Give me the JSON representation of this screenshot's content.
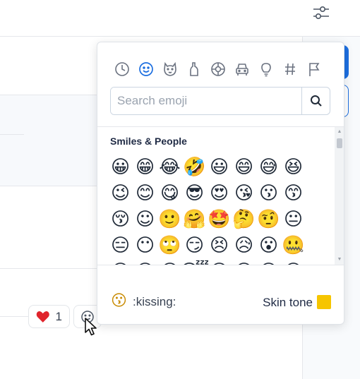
{
  "picker": {
    "categories": [
      {
        "name": "recent",
        "icon": "clock-icon"
      },
      {
        "name": "smileys",
        "icon": "smiley-icon",
        "selected": true
      },
      {
        "name": "animals",
        "icon": "dog-face-icon"
      },
      {
        "name": "food",
        "icon": "bottle-icon"
      },
      {
        "name": "activities",
        "icon": "ball-icon"
      },
      {
        "name": "travel",
        "icon": "car-icon"
      },
      {
        "name": "objects",
        "icon": "lightbulb-icon"
      },
      {
        "name": "symbols",
        "icon": "hash-icon"
      },
      {
        "name": "flags",
        "icon": "flag-icon"
      }
    ],
    "search": {
      "placeholder": "Search emoji",
      "value": ""
    },
    "section_title": "Smiles & People",
    "emojis": [
      "😀",
      "😁",
      "😂",
      "🤣",
      "😃",
      "😄",
      "😅",
      "😆",
      "😉",
      "😊",
      "😋",
      "😎",
      "😍",
      "😘",
      "😗",
      "😙",
      "😚",
      "☺",
      "🙂",
      "🤗",
      "🤩",
      "🤔",
      "🤨",
      "😐",
      "😑",
      "😶",
      "🙄",
      "😏",
      "😣",
      "😥",
      "😮",
      "🤐",
      "😯",
      "😪",
      "😫",
      "😴",
      "😌",
      "😛",
      "😜",
      "😝"
    ],
    "preview": {
      "emoji": "😗",
      "name": ":kissing:"
    },
    "skin_tone": {
      "label": "Skin tone",
      "color": "#f6c500"
    }
  },
  "reactions": [
    {
      "emoji": "❤",
      "count": "1"
    }
  ],
  "colors": {
    "accent": "#1d6fe0",
    "heart": "#e0242c"
  }
}
